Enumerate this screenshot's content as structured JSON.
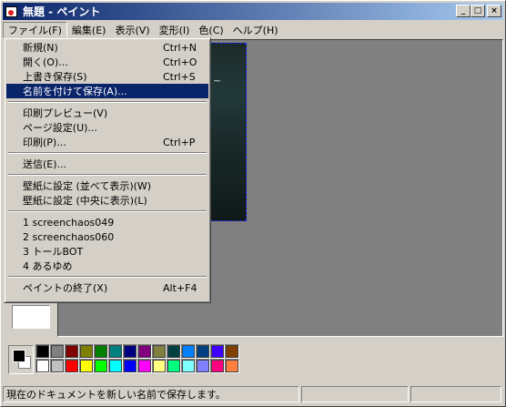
{
  "window": {
    "title": "無題 - ペイント"
  },
  "titlebar_buttons": {
    "minimize": "_",
    "maximize": "□",
    "close": "×"
  },
  "menubar": [
    "ファイル(F)",
    "編集(E)",
    "表示(V)",
    "変形(I)",
    "色(C)",
    "ヘルプ(H)"
  ],
  "file_menu": [
    {
      "label": "新規(N)",
      "accel": "Ctrl+N"
    },
    {
      "label": "開く(O)...",
      "accel": "Ctrl+O"
    },
    {
      "label": "上書き保存(S)",
      "accel": "Ctrl+S"
    },
    {
      "label": "名前を付けて保存(A)...",
      "accel": "",
      "highlighted": true
    },
    {
      "separator": true
    },
    {
      "label": "印刷プレビュー(V)",
      "accel": ""
    },
    {
      "label": "ページ設定(U)...",
      "accel": ""
    },
    {
      "label": "印刷(P)...",
      "accel": "Ctrl+P"
    },
    {
      "separator": true
    },
    {
      "label": "送信(E)...",
      "accel": ""
    },
    {
      "separator": true
    },
    {
      "label": "壁紙に設定 (並べて表示)(W)",
      "accel": ""
    },
    {
      "label": "壁紙に設定 (中央に表示)(L)",
      "accel": ""
    },
    {
      "separator": true
    },
    {
      "label": "1 screenchaos049",
      "accel": ""
    },
    {
      "label": "2 screenchaos060",
      "accel": ""
    },
    {
      "label": "3 トールBOT",
      "accel": ""
    },
    {
      "label": "4 あるゆめ",
      "accel": ""
    },
    {
      "separator": true
    },
    {
      "label": "ペイントの終了(X)",
      "accel": "Alt+F4"
    }
  ],
  "canvas_text": "~",
  "palette": {
    "row1": [
      "#000000",
      "#808080",
      "#800000",
      "#808000",
      "#008000",
      "#008080",
      "#000080",
      "#800080",
      "#808040",
      "#004040",
      "#0080ff",
      "#004080",
      "#4000ff",
      "#804000"
    ],
    "row2": [
      "#ffffff",
      "#c0c0c0",
      "#ff0000",
      "#ffff00",
      "#00ff00",
      "#00ffff",
      "#0000ff",
      "#ff00ff",
      "#ffff80",
      "#00ff80",
      "#80ffff",
      "#8080ff",
      "#ff0080",
      "#ff8040"
    ]
  },
  "statusbar": {
    "text": "現在のドキュメントを新しい名前で保存します。"
  }
}
